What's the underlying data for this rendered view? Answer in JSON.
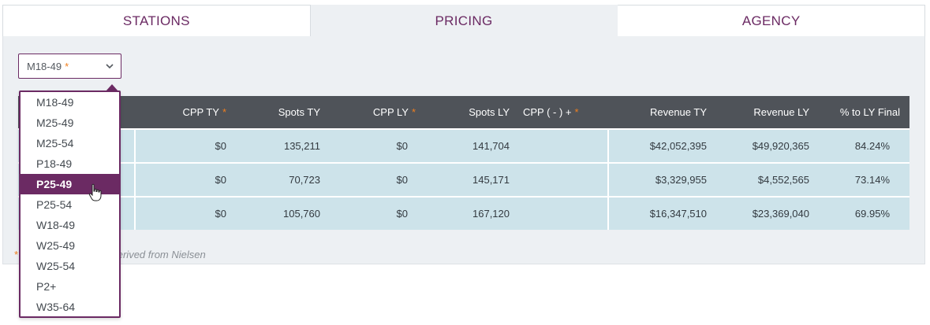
{
  "tabs": [
    {
      "label": "STATIONS",
      "active": false
    },
    {
      "label": "PRICING",
      "active": true
    },
    {
      "label": "AGENCY",
      "active": false
    }
  ],
  "demo_select": {
    "value": "M18-49",
    "required_mark": "*"
  },
  "dropdown": {
    "options": [
      "M18-49",
      "M25-49",
      "M25-54",
      "P18-49",
      "P25-49",
      "P25-54",
      "W18-49",
      "W25-49",
      "W25-54",
      "P2+",
      "W35-64"
    ],
    "selected": "P25-49"
  },
  "table": {
    "headers": {
      "cpp_ty": "CPP TY",
      "spots_ty": "Spots TY",
      "cpp_ly": "CPP LY",
      "spots_ly": "Spots LY",
      "cpp_diff": "CPP ( - ) +",
      "revenue_ty": "Revenue TY",
      "revenue_ly": "Revenue LY",
      "pct_ly_final": "% to LY Final",
      "required_mark": "*"
    },
    "rows": [
      {
        "cpp_ty": "$0",
        "spots_ty": "135,211",
        "cpp_ly": "$0",
        "spots_ly": "141,704",
        "cpp_diff": "",
        "revenue_ty": "$42,052,395",
        "revenue_ly": "$49,920,365",
        "pct_ly_final": "84.24%"
      },
      {
        "cpp_ty": "$0",
        "spots_ty": "70,723",
        "cpp_ly": "$0",
        "spots_ly": "145,171",
        "cpp_diff": "",
        "revenue_ty": "$3,329,955",
        "revenue_ly": "$4,552,565",
        "pct_ly_final": "73.14%"
      },
      {
        "cpp_ty": "$0",
        "spots_ty": "105,760",
        "cpp_ly": "$0",
        "spots_ly": "167,120",
        "cpp_diff": "",
        "revenue_ty": "$16,347,510",
        "revenue_ly": "$23,369,040",
        "pct_ly_final": "69.95%"
      }
    ]
  },
  "footnote": {
    "mark": "*",
    "text": "ta derived from Nielsen"
  },
  "colors": {
    "accent": "#6b2a63",
    "required": "#f07f1e",
    "header_bg": "#4f5359",
    "row_bg": "#cde3ea"
  }
}
